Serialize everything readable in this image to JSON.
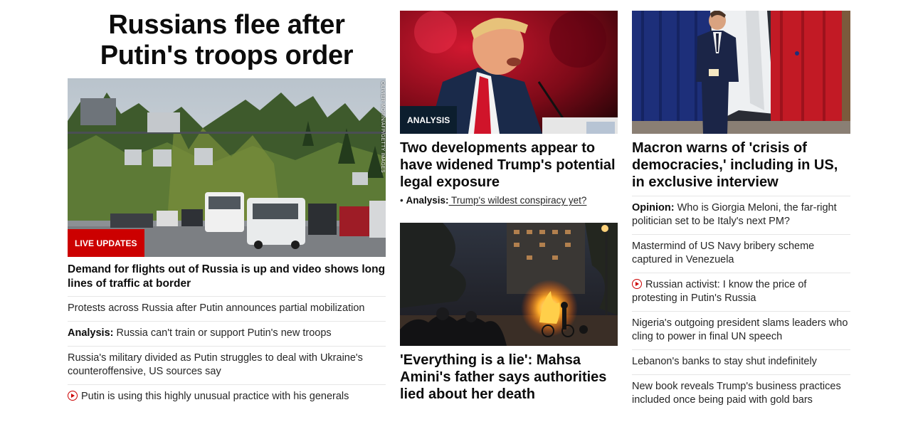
{
  "lead": {
    "title": "Russians flee after Putin's troops order",
    "badge": "LIVE UPDATES",
    "photo_credit": "OLIVIER MORIN/AFP/GETTY IMAGES",
    "headline": "Demand for flights out of Russia is up and video shows long lines of traffic at border",
    "related": [
      {
        "prefix": "",
        "text": "Protests across Russia after Putin announces partial mobilization",
        "video": false
      },
      {
        "prefix": "Analysis:",
        "text": " Russia can't train or support Putin's new troops",
        "video": false
      },
      {
        "prefix": "",
        "text": "Russia's military divided as Putin struggles to deal with Ukraine's counteroffensive, US sources say",
        "video": false
      },
      {
        "prefix": "",
        "text": "Putin is using this highly unusual practice with his generals",
        "video": true
      }
    ]
  },
  "middle": {
    "story1": {
      "badge": "ANALYSIS",
      "headline": "Two developments appear to have widened Trump's potential legal exposure",
      "sub_prefix": "Analysis:",
      "sub_text": " Trump's wildest conspiracy yet?"
    },
    "story2": {
      "headline": "'Everything is a lie': Mahsa Amini's father says authorities lied about her death"
    }
  },
  "right": {
    "headline": "Macron warns of 'crisis of democracies,' including in US, in exclusive interview",
    "items": [
      {
        "prefix": "Opinion:",
        "text": " Who is Giorgia Meloni, the far-right politician set to be Italy's next PM?",
        "video": false
      },
      {
        "prefix": "",
        "text": "Mastermind of US Navy bribery scheme captured in Venezuela",
        "video": false
      },
      {
        "prefix": "",
        "text": "Russian activist: I know the price of protesting in Putin's Russia",
        "video": true
      },
      {
        "prefix": "",
        "text": "Nigeria's outgoing president slams leaders who cling to power in final UN speech",
        "video": false
      },
      {
        "prefix": "",
        "text": "Lebanon's banks to stay shut indefinitely",
        "video": false
      },
      {
        "prefix": "",
        "text": "New book reveals Trump's business practices included once being paid with gold bars",
        "video": false
      }
    ]
  },
  "colors": {
    "live_red": "#cc0000",
    "analysis_navy": "#0c1e2e",
    "text": "#0c0c0c",
    "divider": "#e6e6e6"
  }
}
